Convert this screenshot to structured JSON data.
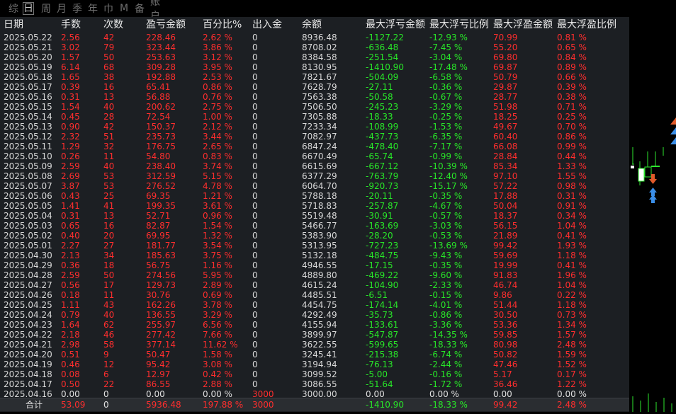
{
  "tabs": [
    "综",
    "日",
    "周",
    "月",
    "季",
    "年",
    "巾",
    "M",
    "备",
    "账户"
  ],
  "active_tab": 1,
  "headers": [
    "日期",
    "手数",
    "次数",
    "盈亏金额",
    "百分比%",
    "出入金",
    "余额",
    "最大浮亏金额",
    "最大浮亏比例",
    "最大浮盈金额",
    "最大浮盈比例"
  ],
  "rows": [
    [
      "2025.05.22",
      "2.56",
      "42",
      "228.46",
      "2.62 %",
      "0",
      "8936.48",
      "-1127.22",
      "-12.93 %",
      "70.99",
      "0.81 %"
    ],
    [
      "2025.05.21",
      "3.02",
      "79",
      "323.44",
      "3.86 %",
      "0",
      "8708.02",
      "-636.48",
      "-7.45 %",
      "55.20",
      "0.65 %"
    ],
    [
      "2025.05.20",
      "1.57",
      "50",
      "253.63",
      "3.12 %",
      "0",
      "8384.58",
      "-251.54",
      "-3.04 %",
      "69.80",
      "0.84 %"
    ],
    [
      "2025.05.19",
      "6.14",
      "68",
      "309.28",
      "3.95 %",
      "0",
      "8130.95",
      "-1410.90",
      "-17.48 %",
      "69.87",
      "0.89 %"
    ],
    [
      "2025.05.18",
      "1.65",
      "38",
      "192.88",
      "2.53 %",
      "0",
      "7821.67",
      "-504.09",
      "-6.58 %",
      "50.79",
      "0.66 %"
    ],
    [
      "2025.05.17",
      "0.39",
      "16",
      "65.41",
      "0.86 %",
      "0",
      "7628.79",
      "-27.11",
      "-0.36 %",
      "29.87",
      "0.39 %"
    ],
    [
      "2025.05.16",
      "0.31",
      "13",
      "56.88",
      "0.76 %",
      "0",
      "7563.38",
      "-50.58",
      "-0.67 %",
      "28.77",
      "0.38 %"
    ],
    [
      "2025.05.15",
      "1.54",
      "40",
      "200.62",
      "2.75 %",
      "0",
      "7506.50",
      "-245.23",
      "-3.29 %",
      "51.98",
      "0.71 %"
    ],
    [
      "2025.05.14",
      "0.45",
      "28",
      "72.54",
      "1.00 %",
      "0",
      "7305.88",
      "-18.33",
      "-0.25 %",
      "18.25",
      "0.25 %"
    ],
    [
      "2025.05.13",
      "0.90",
      "42",
      "150.37",
      "2.12 %",
      "0",
      "7233.34",
      "-108.99",
      "-1.53 %",
      "49.67",
      "0.70 %"
    ],
    [
      "2025.05.12",
      "2.32",
      "51",
      "235.73",
      "3.44 %",
      "0",
      "7082.97",
      "-437.73",
      "-6.35 %",
      "60.40",
      "0.86 %"
    ],
    [
      "2025.05.11",
      "1.29",
      "32",
      "176.75",
      "2.65 %",
      "0",
      "6847.24",
      "-478.40",
      "-7.17 %",
      "66.08",
      "0.99 %"
    ],
    [
      "2025.05.10",
      "0.26",
      "11",
      "54.80",
      "0.83 %",
      "0",
      "6670.49",
      "-65.74",
      "-0.99 %",
      "28.84",
      "0.44 %"
    ],
    [
      "2025.05.09",
      "2.59",
      "40",
      "238.40",
      "3.74 %",
      "0",
      "6615.69",
      "-667.12",
      "-10.39 %",
      "85.34",
      "1.33 %"
    ],
    [
      "2025.05.08",
      "2.69",
      "53",
      "312.59",
      "5.15 %",
      "0",
      "6377.29",
      "-763.79",
      "-12.40 %",
      "97.10",
      "1.55 %"
    ],
    [
      "2025.05.07",
      "3.87",
      "53",
      "276.52",
      "4.78 %",
      "0",
      "6064.70",
      "-920.73",
      "-15.17 %",
      "57.22",
      "0.98 %"
    ],
    [
      "2025.05.06",
      "0.43",
      "25",
      "69.35",
      "1.21 %",
      "0",
      "5788.18",
      "-20.11",
      "-0.35 %",
      "17.88",
      "0.31 %"
    ],
    [
      "2025.05.05",
      "1.41",
      "41",
      "199.35",
      "3.61 %",
      "0",
      "5718.83",
      "-257.87",
      "-4.67 %",
      "50.04",
      "0.91 %"
    ],
    [
      "2025.05.04",
      "0.31",
      "13",
      "52.71",
      "0.96 %",
      "0",
      "5519.48",
      "-30.91",
      "-0.57 %",
      "18.37",
      "0.34 %"
    ],
    [
      "2025.05.03",
      "0.65",
      "16",
      "82.87",
      "1.54 %",
      "0",
      "5466.77",
      "-163.69",
      "-3.03 %",
      "56.15",
      "1.04 %"
    ],
    [
      "2025.05.02",
      "0.40",
      "20",
      "69.95",
      "1.32 %",
      "0",
      "5383.90",
      "-28.20",
      "-0.53 %",
      "21.89",
      "0.41 %"
    ],
    [
      "2025.05.01",
      "2.27",
      "27",
      "181.77",
      "3.54 %",
      "0",
      "5313.95",
      "-727.23",
      "-13.69 %",
      "99.42",
      "1.93 %"
    ],
    [
      "2025.04.30",
      "2.13",
      "34",
      "185.63",
      "3.75 %",
      "0",
      "5132.18",
      "-484.75",
      "-9.43 %",
      "59.69",
      "1.18 %"
    ],
    [
      "2025.04.29",
      "0.36",
      "18",
      "56.75",
      "1.16 %",
      "0",
      "4946.55",
      "-17.15",
      "-0.35 %",
      "19.99",
      "0.41 %"
    ],
    [
      "2025.04.28",
      "2.59",
      "50",
      "274.56",
      "5.95 %",
      "0",
      "4889.80",
      "-469.22",
      "-9.60 %",
      "91.83",
      "1.96 %"
    ],
    [
      "2025.04.27",
      "0.56",
      "17",
      "129.73",
      "2.89 %",
      "0",
      "4615.24",
      "-104.90",
      "-2.33 %",
      "46.74",
      "1.04 %"
    ],
    [
      "2025.04.26",
      "0.18",
      "11",
      "30.76",
      "0.69 %",
      "0",
      "4485.51",
      "-6.51",
      "-0.15 %",
      "9.86",
      "0.22 %"
    ],
    [
      "2025.04.25",
      "1.11",
      "43",
      "162.26",
      "3.78 %",
      "0",
      "4454.75",
      "-174.14",
      "-4.01 %",
      "51.44",
      "1.18 %"
    ],
    [
      "2025.04.24",
      "0.79",
      "40",
      "136.55",
      "3.29 %",
      "0",
      "4292.49",
      "-35.73",
      "-0.86 %",
      "30.50",
      "0.73 %"
    ],
    [
      "2025.04.23",
      "1.64",
      "62",
      "255.97",
      "6.56 %",
      "0",
      "4155.94",
      "-133.61",
      "-3.36 %",
      "53.36",
      "1.34 %"
    ],
    [
      "2025.04.22",
      "2.18",
      "46",
      "277.42",
      "7.66 %",
      "0",
      "3899.97",
      "-547.87",
      "-14.35 %",
      "59.85",
      "1.57 %"
    ],
    [
      "2025.04.21",
      "2.98",
      "58",
      "377.14",
      "11.62 %",
      "0",
      "3622.55",
      "-599.65",
      "-18.33 %",
      "80.98",
      "2.48 %"
    ],
    [
      "2025.04.20",
      "0.51",
      "9",
      "50.47",
      "1.58 %",
      "0",
      "3245.41",
      "-215.38",
      "-6.74 %",
      "50.82",
      "1.59 %"
    ],
    [
      "2025.04.19",
      "0.46",
      "12",
      "95.42",
      "3.08 %",
      "0",
      "3194.94",
      "-76.13",
      "-2.44 %",
      "47.46",
      "1.52 %"
    ],
    [
      "2025.04.18",
      "0.08",
      "6",
      "12.97",
      "0.42 %",
      "0",
      "3099.52",
      "-5.00",
      "-0.16 %",
      "5.17",
      "0.17 %"
    ],
    [
      "2025.04.17",
      "0.50",
      "22",
      "86.55",
      "2.88 %",
      "0",
      "3086.55",
      "-51.64",
      "-1.72 %",
      "36.46",
      "1.22 %"
    ],
    [
      "2025.04.16",
      "0.00",
      "0",
      "0.00",
      "0.00 %",
      "3000",
      "3000.00",
      "0.00",
      "0.00 %",
      "0.00",
      "0.00 %"
    ]
  ],
  "total": {
    "label": "合计",
    "lots": "53.09",
    "count": "0",
    "pnl": "5936.48",
    "pct": "197.88 %",
    "deposit": "3000",
    "max_dd": "-1410.90",
    "max_dd_pct": "-18.33 %",
    "max_fp": "99.42",
    "max_fp_pct": "2.48 %"
  },
  "colors": {
    "positive": "#ff2e2e",
    "negative": "#28e628",
    "panel_bg": "#1c1f23",
    "total_bg": "#2a2d31"
  }
}
